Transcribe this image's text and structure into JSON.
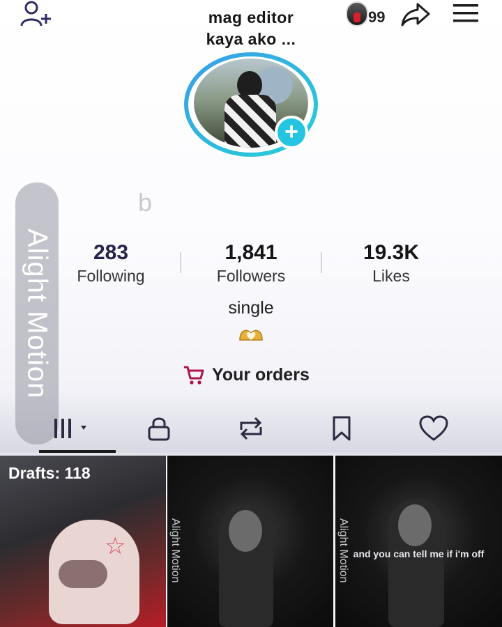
{
  "header": {
    "title_line1": "mag editor",
    "title_line2": "kaya ako ...",
    "notification_count": "99",
    "add_friend_icon": "person-plus-icon",
    "share_icon": "share-arrow-icon",
    "menu_icon": "hamburger-menu-icon"
  },
  "profile": {
    "name_fragment": "b",
    "watermark": "Alight Motion"
  },
  "stats": [
    {
      "value": "283",
      "label": "Following"
    },
    {
      "value": "1,841",
      "label": "Followers"
    },
    {
      "value": "19.3K",
      "label": "Likes"
    }
  ],
  "bio": {
    "text": "single",
    "emoji": "heart-hands-emoji"
  },
  "orders": {
    "label": "Your orders",
    "icon": "cart-icon"
  },
  "tabs": [
    {
      "name": "videos",
      "icon": "grid-icon"
    },
    {
      "name": "private",
      "icon": "lock-icon"
    },
    {
      "name": "reposts",
      "icon": "repost-icon"
    },
    {
      "name": "favorites",
      "icon": "bookmark-icon"
    },
    {
      "name": "liked",
      "icon": "heart-icon"
    }
  ],
  "videos": [
    {
      "overlay": "Drafts: 118",
      "caption": ""
    },
    {
      "overlay": "",
      "watermark": "Alight Motion",
      "caption": ""
    },
    {
      "overlay": "",
      "watermark": "Alight Motion",
      "caption": "and you can tell me if i'm off"
    }
  ],
  "colors": {
    "accent_cyan": "#25c4e0",
    "ring_blue": "#3a9ee6",
    "tab_icon": "#2a2a40",
    "orders_icon": "#b0124a"
  }
}
